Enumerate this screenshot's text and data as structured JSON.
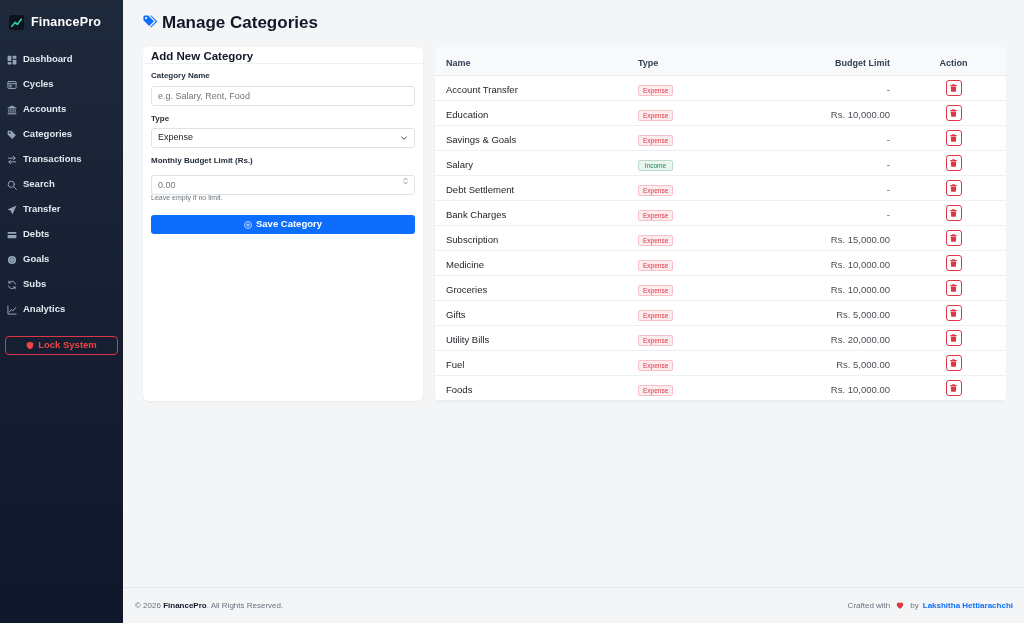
{
  "sidebar": {
    "brand": "FinancePro",
    "items": [
      {
        "label": "Dashboard",
        "selected": false
      },
      {
        "label": "Cycles",
        "selected": false
      },
      {
        "label": "Accounts",
        "selected": false
      },
      {
        "label": "Categories",
        "selected": false
      },
      {
        "label": "Transactions",
        "selected": false
      },
      {
        "label": "Search",
        "selected": false
      },
      {
        "label": "Transfer",
        "selected": false
      },
      {
        "label": "Debts",
        "selected": false
      },
      {
        "label": "Goals",
        "selected": false
      },
      {
        "label": "Subs",
        "selected": false
      },
      {
        "label": "Analytics",
        "selected": false
      }
    ],
    "lock_button": "Lock System"
  },
  "page": {
    "title": "Manage Categories"
  },
  "form": {
    "title": "Add New Category",
    "fields": [
      {
        "kind": "text",
        "label": "Category Name",
        "placeholder": "e.g. Salary, Rent, Food"
      },
      {
        "kind": "select",
        "label": "Type",
        "value": "Expense"
      },
      {
        "kind": "number",
        "label": "Monthly Budget Limit (Rs.)",
        "placeholder": "0.00",
        "hint": "Leave empty if no limit."
      }
    ],
    "submit": "Save Category"
  },
  "table": {
    "columns": [
      "Name",
      "Type",
      "Budget Limit",
      "Action"
    ],
    "rows": [
      {
        "name": "Account Transfer",
        "type": "Expense",
        "kind": "expense",
        "budget_limit": "-"
      },
      {
        "name": "Education",
        "type": "Expense",
        "kind": "expense",
        "budget_limit": "Rs. 10,000.00"
      },
      {
        "name": "Savings & Goals",
        "type": "Expense",
        "kind": "expense",
        "budget_limit": "-"
      },
      {
        "name": "Salary",
        "type": "Income",
        "kind": "income",
        "budget_limit": "-"
      },
      {
        "name": "Debt Settlement",
        "type": "Expense",
        "kind": "expense",
        "budget_limit": "-"
      },
      {
        "name": "Bank Charges",
        "type": "Expense",
        "kind": "expense",
        "budget_limit": "-"
      },
      {
        "name": "Subscription",
        "type": "Expense",
        "kind": "expense",
        "budget_limit": "Rs. 15,000.00"
      },
      {
        "name": "Medicine",
        "type": "Expense",
        "kind": "expense",
        "budget_limit": "Rs. 10,000.00"
      },
      {
        "name": "Groceries",
        "type": "Expense",
        "kind": "expense",
        "budget_limit": "Rs. 10,000.00"
      },
      {
        "name": "Gifts",
        "type": "Expense",
        "kind": "expense",
        "budget_limit": "Rs. 5,000.00"
      },
      {
        "name": "Utility Bills",
        "type": "Expense",
        "kind": "expense",
        "budget_limit": "Rs. 20,000.00"
      },
      {
        "name": "Fuel",
        "type": "Expense",
        "kind": "expense",
        "budget_limit": "Rs. 5,000.00"
      },
      {
        "name": "Foods",
        "type": "Expense",
        "kind": "expense",
        "budget_limit": "Rs. 10,000.00"
      }
    ]
  },
  "footer": {
    "copyright": "© 2026 **FinancePro**. All Rights Reserved.",
    "credit_prefix": "Crafted with",
    "credit_by": "by",
    "author": "Lakshitha Hettiarachchi"
  }
}
